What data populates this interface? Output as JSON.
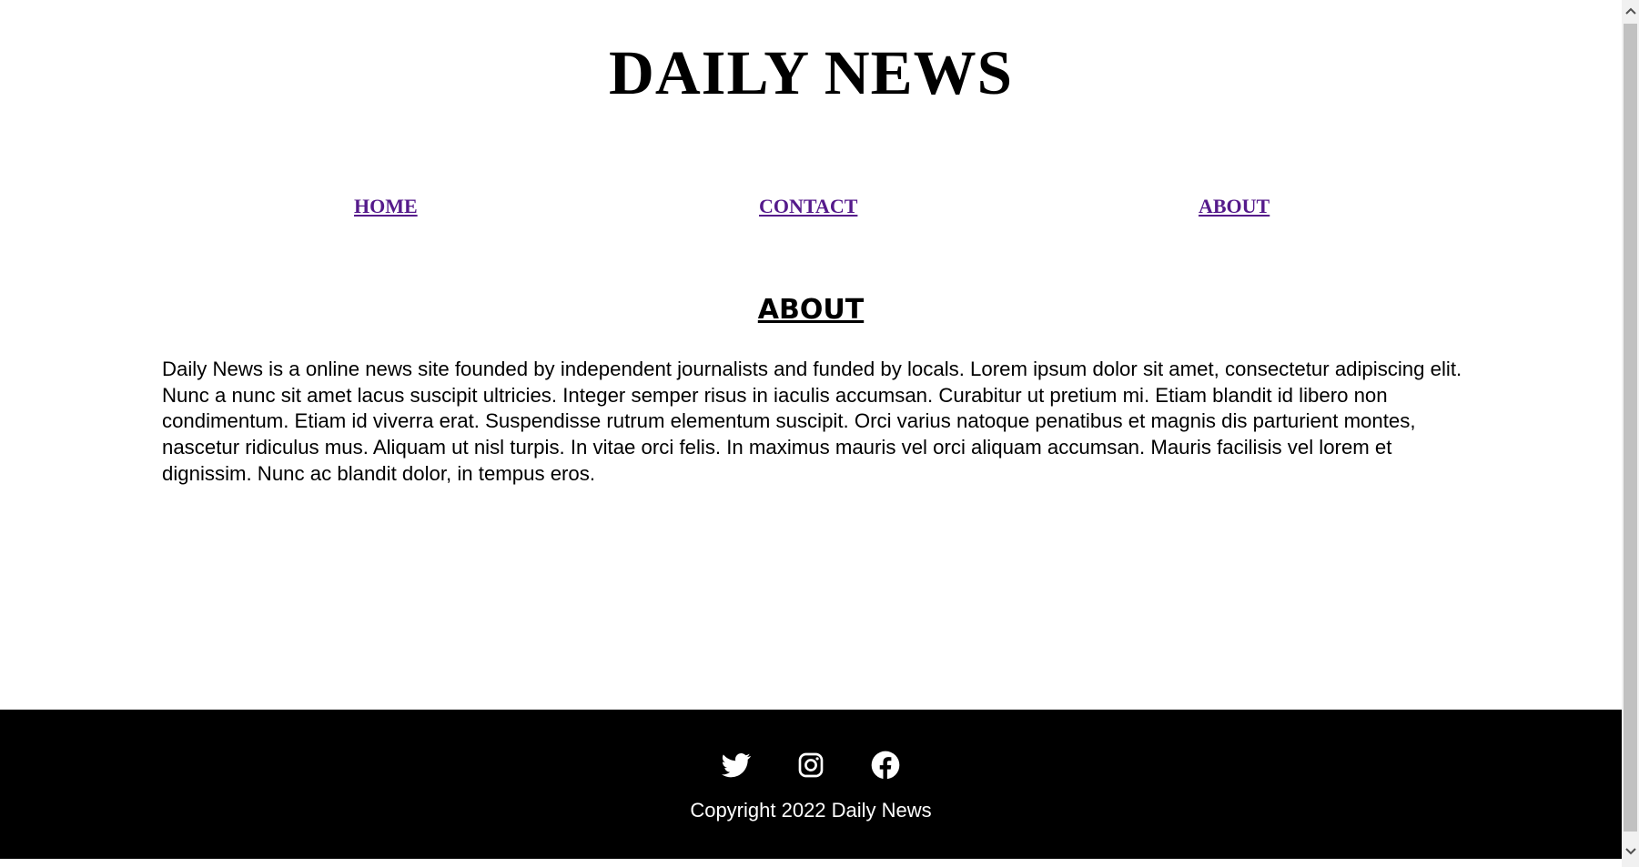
{
  "header": {
    "title": "DAILY NEWS"
  },
  "nav": {
    "home": "HOME",
    "contact": "CONTACT",
    "about": "ABOUT"
  },
  "main": {
    "heading": "ABOUT",
    "paragraph": "Daily News is a online news site founded by independent journalists and funded by locals. Lorem ipsum dolor sit amet, consectetur adipiscing elit. Nunc a nunc sit amet lacus suscipit ultricies. Integer semper risus in iaculis accumsan. Curabitur ut pretium mi. Etiam blandit id libero non condimentum. Etiam id viverra erat. Suspendisse rutrum elementum suscipit. Orci varius natoque penatibus et magnis dis parturient montes, nascetur ridiculus mus. Aliquam ut nisl turpis. In vitae orci felis. In maximus mauris vel orci aliquam accumsan. Mauris facilisis vel lorem et dignissim. Nunc ac blandit dolor, in tempus eros."
  },
  "footer": {
    "social_icons": [
      "twitter-icon",
      "instagram-icon",
      "facebook-icon"
    ],
    "copyright": "Copyright 2022 Daily News"
  },
  "colors": {
    "link": "#551a8b",
    "footer_bg": "#000000",
    "footer_text": "#ffffff"
  }
}
